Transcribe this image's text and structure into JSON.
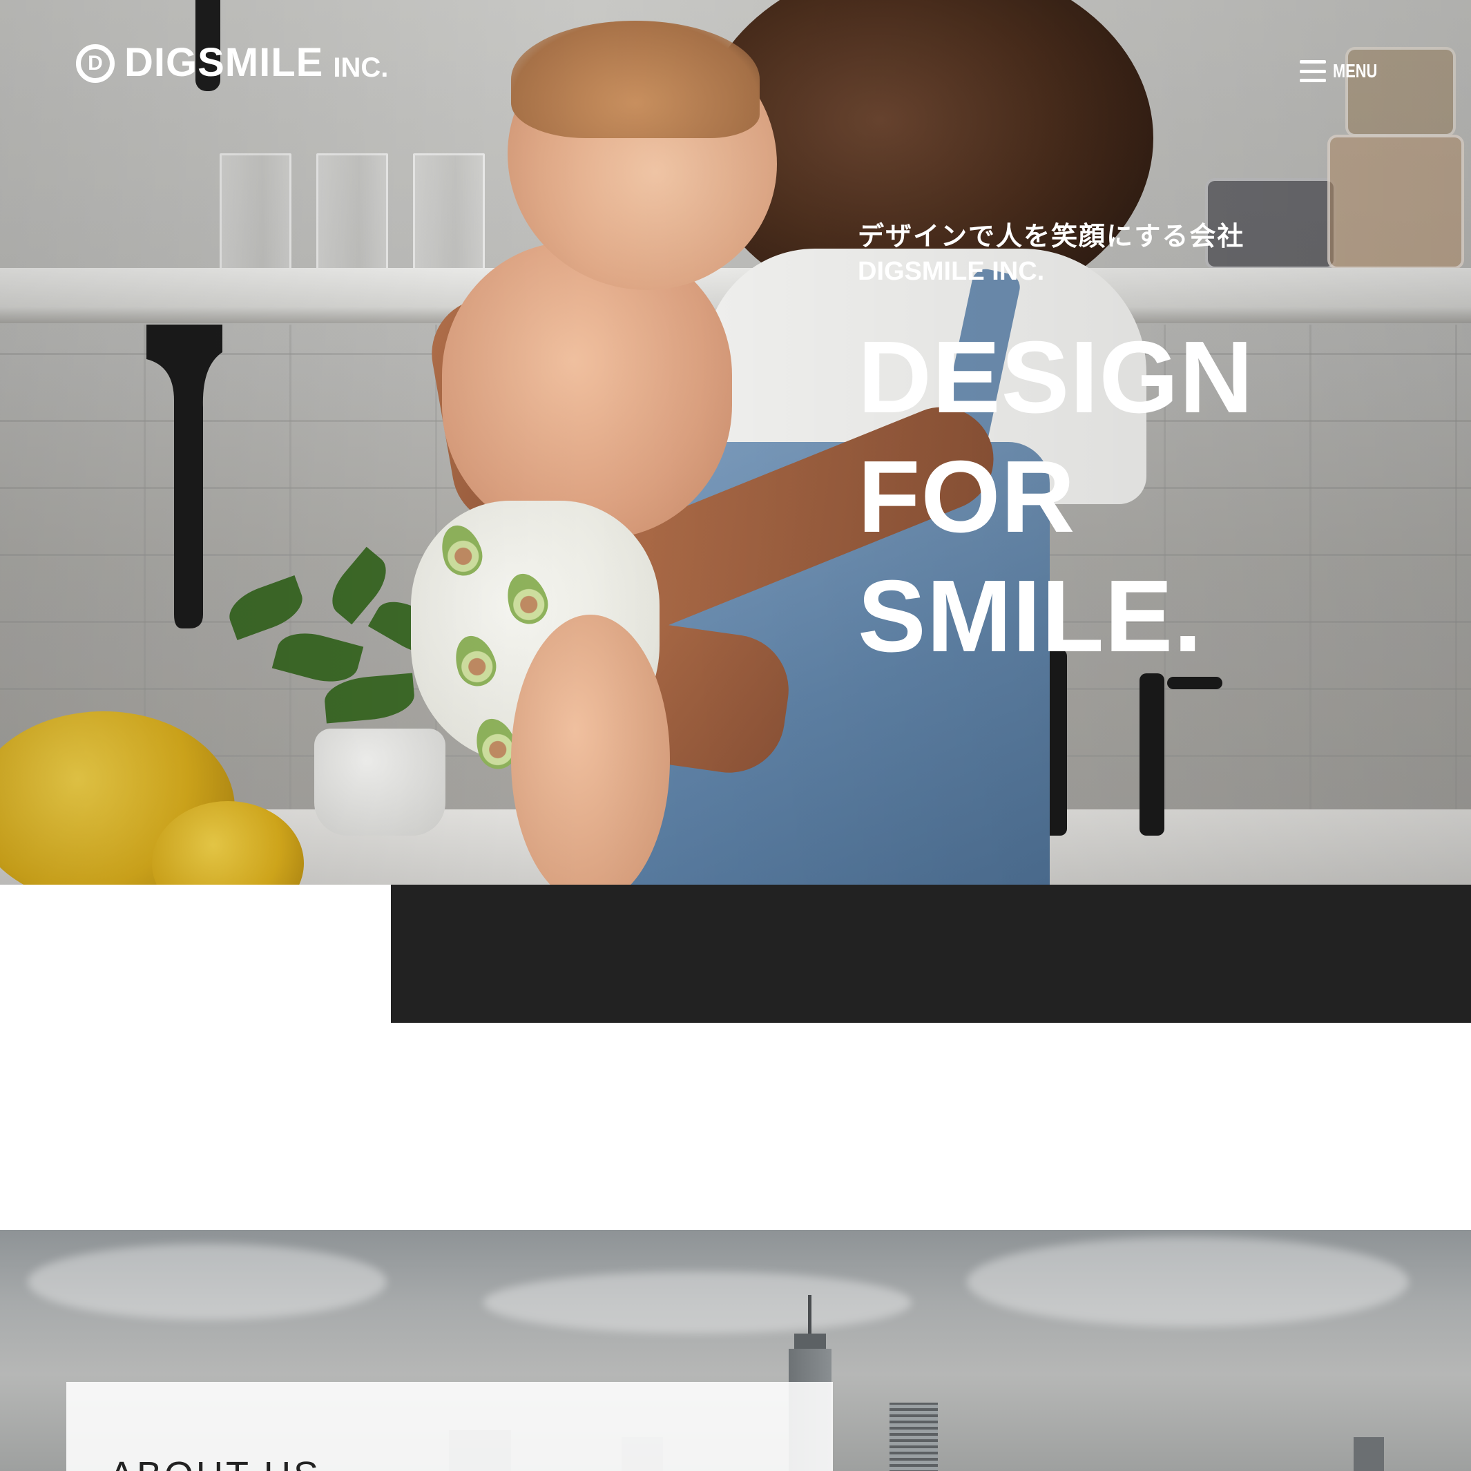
{
  "header": {
    "logo_name": "DIGSMILE",
    "logo_suffix": "INC.",
    "logo_mark": "D",
    "menu_label": "MENU"
  },
  "hero": {
    "tagline_jp": "デザインで人を笑顔にする会社",
    "tagline_en": "DIGSMILE INC.",
    "headline_lines": [
      "DESIGN",
      "FOR",
      "SMILE."
    ]
  },
  "about": {
    "title": "ABOUT US"
  },
  "icons": {
    "menu": "hamburger-menu-icon",
    "logo": "digsmile-logo-mark"
  },
  "colors": {
    "band": "#222222",
    "text_on_image": "#ffffff",
    "about_title": "#222222"
  }
}
